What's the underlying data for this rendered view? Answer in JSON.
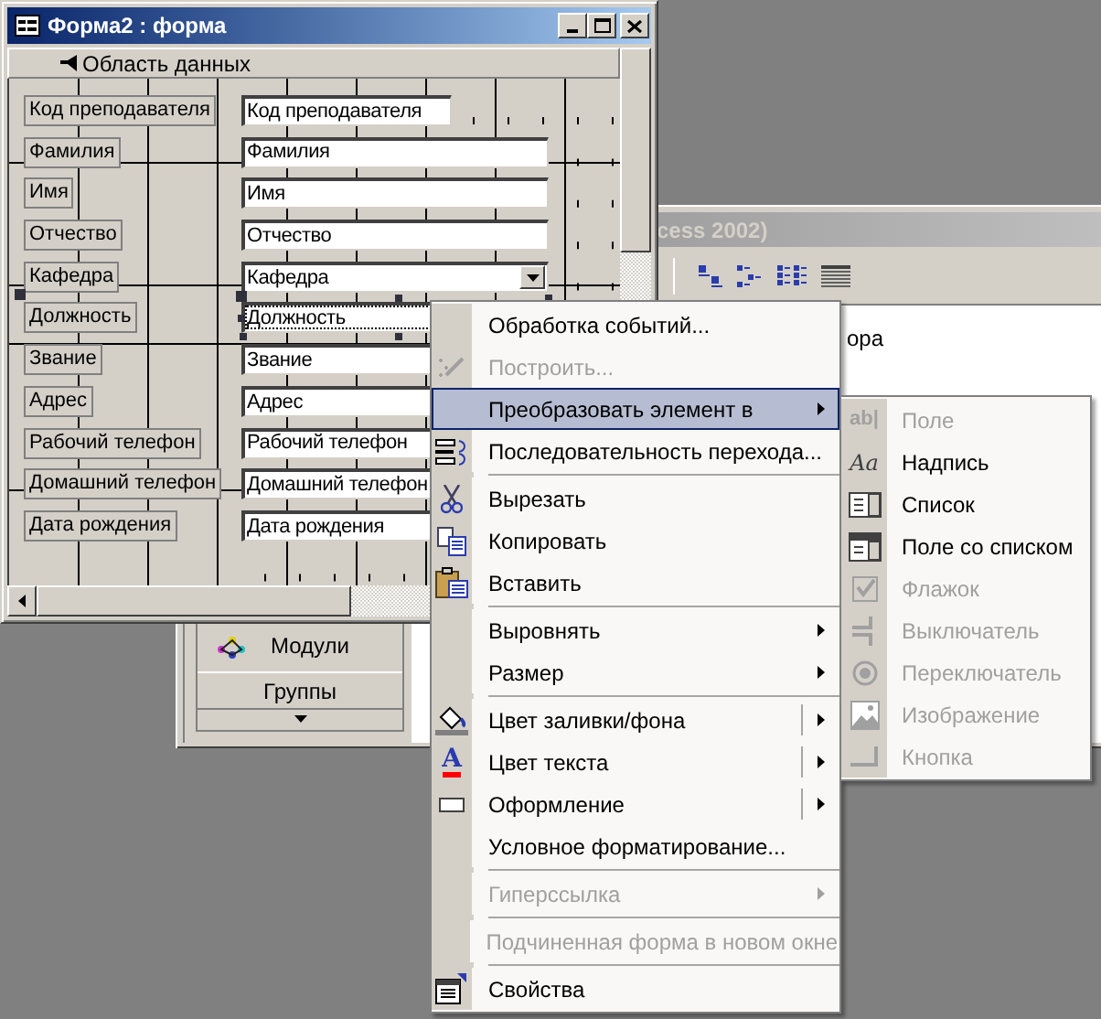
{
  "db_window": {
    "title": "cess 2002)",
    "text": "ора",
    "sidebar_items": [
      {
        "label": "Модули",
        "kind": "object"
      },
      {
        "label": "Группы",
        "kind": "bar"
      }
    ]
  },
  "form_window": {
    "title": "Форма2 : форма",
    "section": "Область данных",
    "fields": [
      {
        "label": "Код преподавателя",
        "value": "Код преподавателя",
        "kind": "short",
        "selected": false
      },
      {
        "label": "Фамилия",
        "value": "Фамилия",
        "kind": "text",
        "selected": false
      },
      {
        "label": "Имя",
        "value": "Имя",
        "kind": "text",
        "selected": false
      },
      {
        "label": "Отчество",
        "value": "Отчество",
        "kind": "text",
        "selected": false
      },
      {
        "label": "Кафедра",
        "value": "Кафедра",
        "kind": "combo",
        "selected": false
      },
      {
        "label": "Должность",
        "value": "Должность",
        "kind": "text",
        "selected": true
      },
      {
        "label": "Звание",
        "value": "Звание",
        "kind": "text",
        "selected": false
      },
      {
        "label": "Адрес",
        "value": "Адрес",
        "kind": "text",
        "selected": false
      },
      {
        "label": "Рабочий телефон",
        "value": "Рабочий телефон",
        "kind": "text",
        "selected": false
      },
      {
        "label": "Домашний телефон",
        "value": "Домашний телефон",
        "kind": "text",
        "selected": false
      },
      {
        "label": "Дата рождения",
        "value": "Дата рождения",
        "kind": "text",
        "selected": false
      }
    ]
  },
  "context_menu": {
    "items": [
      {
        "kind": "item",
        "label": "Обработка событий...",
        "disabled": false,
        "submenu": false,
        "split": false,
        "selected": false
      },
      {
        "kind": "item",
        "label": "Построить...",
        "disabled": true,
        "submenu": false,
        "split": false,
        "selected": false
      },
      {
        "kind": "item",
        "label": "Преобразовать элемент в",
        "disabled": false,
        "submenu": true,
        "split": false,
        "selected": true
      },
      {
        "kind": "item",
        "label": "Последовательность перехода...",
        "disabled": false,
        "submenu": false,
        "split": false,
        "selected": false
      },
      {
        "kind": "separator"
      },
      {
        "kind": "item",
        "label": "Вырезать",
        "disabled": false,
        "submenu": false,
        "split": false,
        "selected": false
      },
      {
        "kind": "item",
        "label": "Копировать",
        "disabled": false,
        "submenu": false,
        "split": false,
        "selected": false
      },
      {
        "kind": "item",
        "label": "Вставить",
        "disabled": false,
        "submenu": false,
        "split": false,
        "selected": false
      },
      {
        "kind": "separator"
      },
      {
        "kind": "item",
        "label": "Выровнять",
        "disabled": false,
        "submenu": true,
        "split": false,
        "selected": false
      },
      {
        "kind": "item",
        "label": "Размер",
        "disabled": false,
        "submenu": true,
        "split": false,
        "selected": false
      },
      {
        "kind": "separator"
      },
      {
        "kind": "item",
        "label": "Цвет заливки/фона",
        "disabled": false,
        "submenu": true,
        "split": true,
        "selected": false
      },
      {
        "kind": "item",
        "label": "Цвет текста",
        "glyph": "A",
        "disabled": false,
        "submenu": true,
        "split": true,
        "selected": false
      },
      {
        "kind": "item",
        "label": "Оформление",
        "disabled": false,
        "submenu": true,
        "split": true,
        "selected": false
      },
      {
        "kind": "item",
        "label": "Условное форматирование...",
        "disabled": false,
        "submenu": false,
        "split": false,
        "selected": false
      },
      {
        "kind": "separator"
      },
      {
        "kind": "item",
        "label": "Гиперссылка",
        "disabled": true,
        "submenu": true,
        "split": false,
        "selected": false
      },
      {
        "kind": "separator"
      },
      {
        "kind": "item",
        "label": "Подчиненная форма в новом окне",
        "disabled": true,
        "submenu": false,
        "split": false,
        "selected": false
      },
      {
        "kind": "separator"
      },
      {
        "kind": "item",
        "label": "Свойства",
        "disabled": false,
        "submenu": false,
        "split": false,
        "selected": false
      }
    ]
  },
  "submenu": {
    "items": [
      {
        "label": "Поле",
        "glyph": "ab|",
        "disabled": true
      },
      {
        "label": "Надпись",
        "glyph": "Aa",
        "disabled": false
      },
      {
        "label": "Список",
        "disabled": false
      },
      {
        "label": "Поле со списком",
        "disabled": false
      },
      {
        "label": "Флажок",
        "disabled": true
      },
      {
        "label": "Выключатель",
        "disabled": true
      },
      {
        "label": "Переключатель",
        "disabled": true
      },
      {
        "label": "Изображение",
        "disabled": true
      },
      {
        "label": "Кнопка",
        "disabled": true
      }
    ]
  }
}
